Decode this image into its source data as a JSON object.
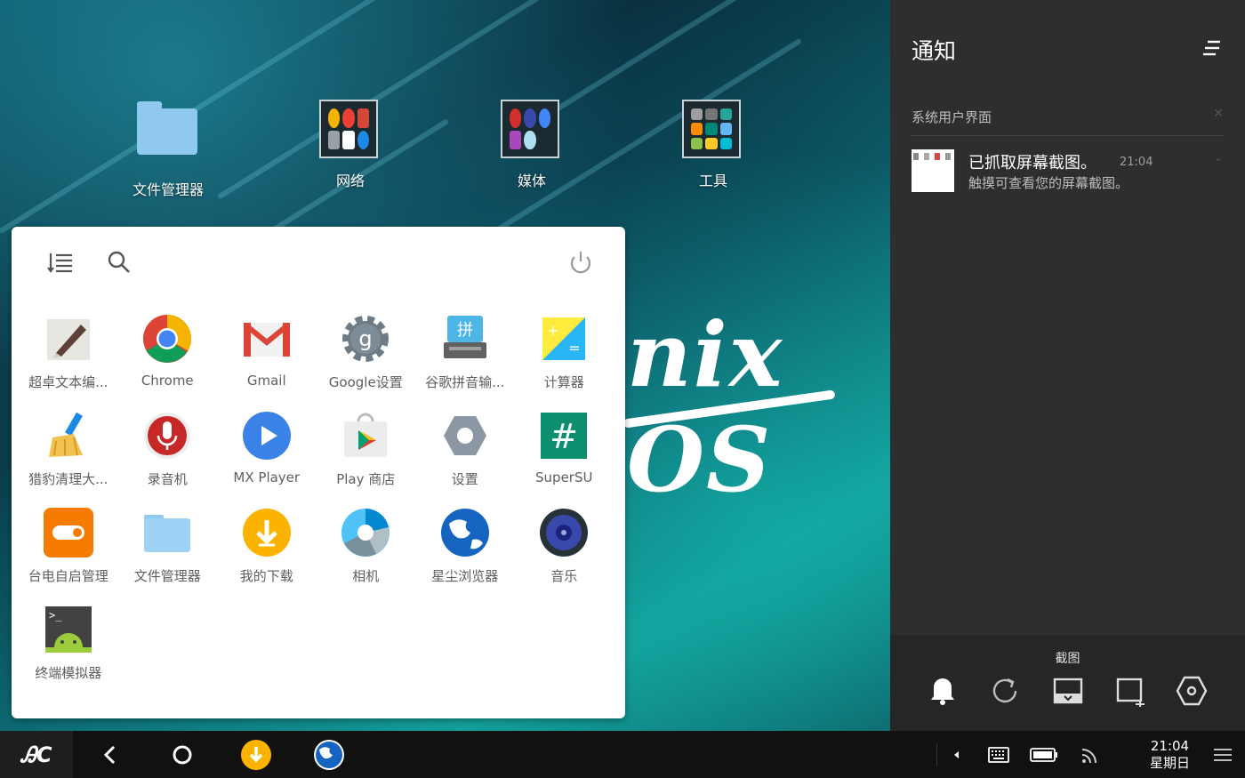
{
  "desktop": {
    "icons": [
      {
        "label": "文件管理器",
        "icon": "folder-icon"
      },
      {
        "label": "网络",
        "icon": "folder-group-icon"
      },
      {
        "label": "媒体",
        "icon": "folder-group-icon"
      },
      {
        "label": "工具",
        "icon": "folder-group-icon"
      }
    ],
    "wallpaper_text": "nix OS"
  },
  "launcher": {
    "apps": [
      {
        "label": "超卓文本编...",
        "icon": "text-editor-icon"
      },
      {
        "label": "Chrome",
        "icon": "chrome-icon"
      },
      {
        "label": "Gmail",
        "icon": "gmail-icon"
      },
      {
        "label": "Google设置",
        "icon": "google-settings-icon"
      },
      {
        "label": "谷歌拼音输...",
        "icon": "pinyin-keyboard-icon"
      },
      {
        "label": "计算器",
        "icon": "calculator-icon"
      },
      {
        "label": "猎豹清理大...",
        "icon": "broom-icon"
      },
      {
        "label": "录音机",
        "icon": "microphone-icon"
      },
      {
        "label": "MX Player",
        "icon": "play-icon"
      },
      {
        "label": "Play 商店",
        "icon": "play-store-icon"
      },
      {
        "label": "设置",
        "icon": "settings-icon"
      },
      {
        "label": "SuperSU",
        "icon": "supersu-icon"
      },
      {
        "label": "台电自启管理",
        "icon": "toggle-icon"
      },
      {
        "label": "文件管理器",
        "icon": "folder-icon"
      },
      {
        "label": "我的下载",
        "icon": "download-icon"
      },
      {
        "label": "相机",
        "icon": "camera-icon"
      },
      {
        "label": "星尘浏览器",
        "icon": "globe-icon"
      },
      {
        "label": "音乐",
        "icon": "speaker-icon"
      },
      {
        "label": "终端模拟器",
        "icon": "terminal-icon"
      }
    ]
  },
  "notifications": {
    "title": "通知",
    "section": "系统用户界面",
    "items": [
      {
        "title": "已抓取屏幕截图。",
        "time": "21:04",
        "text": "触摸可查看您的屏幕截图。"
      }
    ],
    "quick_label": "截图",
    "quick_buttons": [
      "bell-icon",
      "rotate-icon",
      "screenshot-icon",
      "crop-icon",
      "settings-hex-icon"
    ]
  },
  "taskbar": {
    "start_label": "ᎯC",
    "pinned": [
      "back-icon",
      "home-icon",
      "download-icon",
      "globe-icon"
    ],
    "clock": {
      "time": "21:04",
      "day": "星期日"
    }
  },
  "colors": {
    "panel_bg": "#2e2e2e",
    "taskbar_bg": "#111111",
    "launcher_bg": "#ffffff",
    "label_gray": "#5f5f5f"
  }
}
